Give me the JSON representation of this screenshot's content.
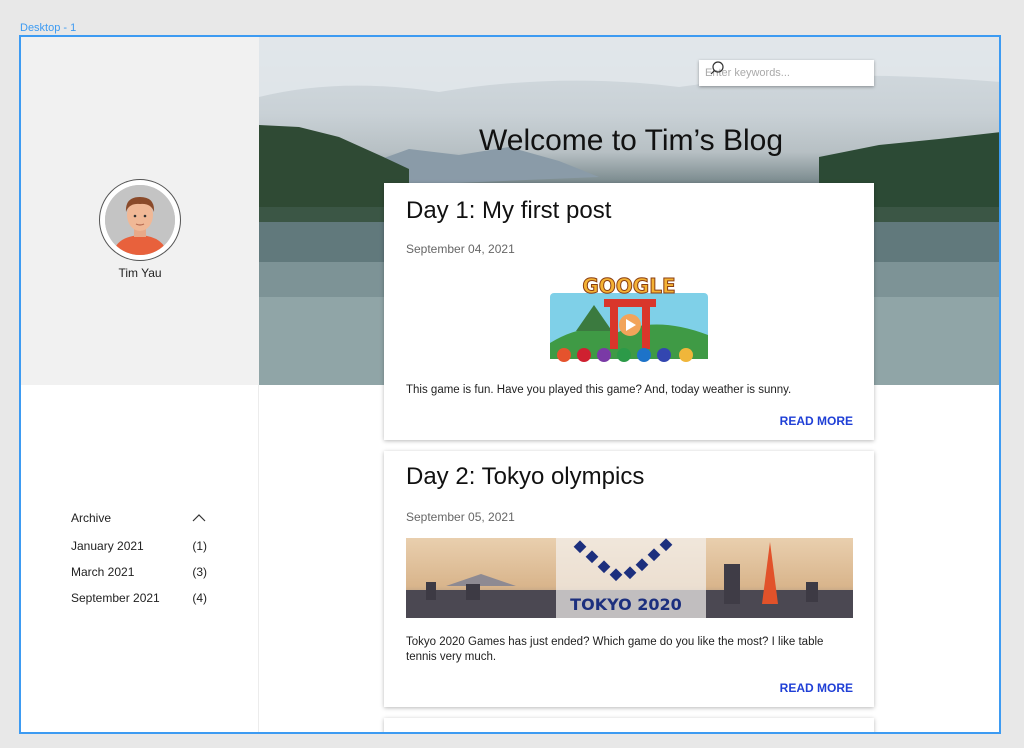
{
  "frame": {
    "label": "Desktop - 1"
  },
  "profile": {
    "name": "Tim Yau"
  },
  "archive": {
    "title": "Archive",
    "items": [
      {
        "month": "January 2021",
        "count": "(1)"
      },
      {
        "month": "March 2021",
        "count": "(3)"
      },
      {
        "month": "September 2021",
        "count": "(4)"
      }
    ]
  },
  "hero": {
    "title": "Welcome to Tim’s Blog"
  },
  "search": {
    "placeholder": "Enter keywords..."
  },
  "posts": [
    {
      "title": "Day 1: My first post",
      "date": "September 04, 2021",
      "text": "This game is fun. Have you played this game? And, today weather is sunny.",
      "read_more": "READ MORE",
      "image_text": "GOOGLE"
    },
    {
      "title": "Day 2: Tokyo olympics",
      "date": "September 05, 2021",
      "text": "Tokyo 2020 Games has just ended? Which game do you like the most? I like table tennis very much.",
      "read_more": "READ MORE",
      "image_text": "TOKYO 2020"
    }
  ],
  "colors": {
    "frame_outline": "#3d9bf2",
    "link": "#1f3fd6",
    "sidebar_bg": "#f1f1f1"
  }
}
